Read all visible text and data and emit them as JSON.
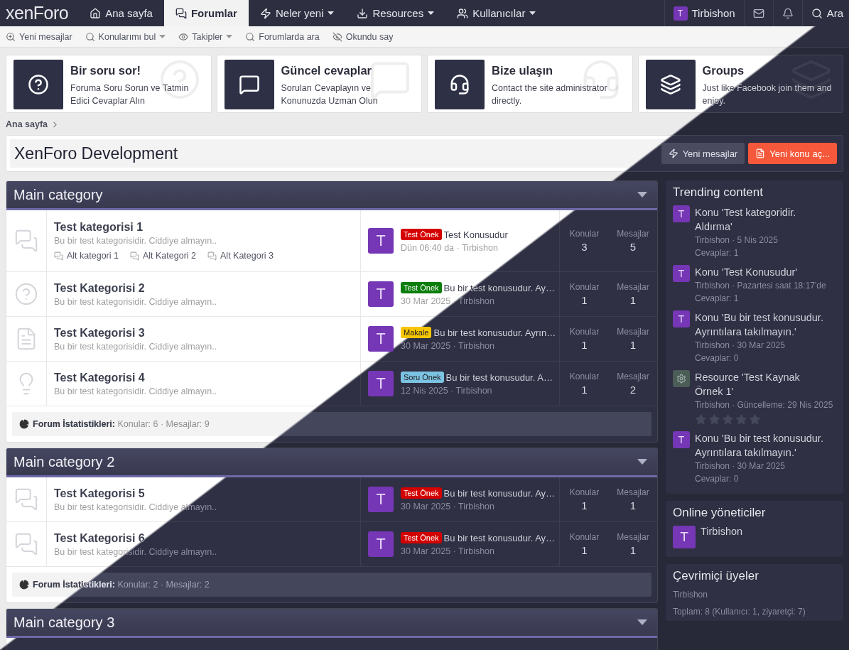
{
  "nav": {
    "logo": "xenForo",
    "tabs": [
      {
        "label": "Ana sayfa",
        "selected": false,
        "dropdown": false
      },
      {
        "label": "Forumlar",
        "selected": true,
        "dropdown": false
      },
      {
        "label": "Neler yeni",
        "selected": false,
        "dropdown": true
      },
      {
        "label": "Resources",
        "selected": false,
        "dropdown": true
      },
      {
        "label": "Kullanıcılar",
        "selected": false,
        "dropdown": true
      }
    ],
    "user": {
      "avatar": "T",
      "name": "Tirbishon"
    },
    "search": "Ara"
  },
  "subnav": [
    {
      "label": "Yeni mesajlar",
      "dropdown": false
    },
    {
      "label": "Konularımı bul",
      "dropdown": true
    },
    {
      "label": "Takipler",
      "dropdown": true
    },
    {
      "label": "Forumlarda ara",
      "dropdown": false
    },
    {
      "label": "Okundu say",
      "dropdown": false
    }
  ],
  "cards": [
    {
      "title": "Bir soru sor!",
      "text": "Foruma Soru Sorun ve Tatmin Edici Cevaplar Alın"
    },
    {
      "title": "Güncel cevaplar",
      "text": "Soruları Cevaplayın ve Konunuzda Uzman Olun"
    },
    {
      "title": "Bize ulaşın",
      "text": "Contact the site administrator directly."
    },
    {
      "title": "Groups",
      "text": "Just like Facebook join them and enjoy."
    }
  ],
  "breadcrumb": [
    "Ana sayfa"
  ],
  "page_title": "XenForo Development",
  "actions": [
    {
      "label": "Yeni mesajlar",
      "kind": "secondary"
    },
    {
      "label": "Yeni konu aç...",
      "kind": "primary"
    }
  ],
  "categories": [
    {
      "title": "Main category",
      "forums": [
        {
          "kind": "chat",
          "title": "Test kategorisi 1",
          "description": "Bu bir test kategorisidir. Ciddiye almayın..",
          "subforums": [
            "Alt kategori 1",
            "Alt Kategori 2",
            "Alt Kategori 3"
          ],
          "last_post": {
            "avatar": "T",
            "prefix": {
              "label": "Test Önek",
              "color": "#d40000"
            },
            "title": "Test Konusudur",
            "meta": "Dün 06:40 da · Tirbishon"
          },
          "threads_label": "Konular",
          "threads": "3",
          "messages_label": "Mesajlar",
          "messages": "5"
        },
        {
          "kind": "question",
          "title": "Test Kategorisi 2",
          "description": "Bu bir test kategorisidir. Ciddiye almayın..",
          "last_post": {
            "avatar": "T",
            "prefix": {
              "label": "Test Önek",
              "color": "#0a7d0a"
            },
            "title": "Bu bir test konusudur. Ay…",
            "meta": "30 Mar 2025 · Tirbishon"
          },
          "threads_label": "Konular",
          "threads": "1",
          "messages_label": "Mesajlar",
          "messages": "1"
        },
        {
          "kind": "document",
          "title": "Test Kategorisi 3",
          "description": "Bu bir test kategorisidir. Ciddiye almayın..",
          "last_post": {
            "avatar": "T",
            "prefix": {
              "label": "Makale",
              "color": "#f7c600"
            },
            "title": "Bu bir test konusudur. Ayrın…",
            "meta": "30 Mar 2025 · Tirbishon"
          },
          "threads_label": "Konular",
          "threads": "1",
          "messages_label": "Mesajlar",
          "messages": "1"
        },
        {
          "kind": "idea",
          "title": "Test Kategorisi 4",
          "description": "Bu bir test kategorisidir. Ciddiye almayın..",
          "last_post": {
            "avatar": "T",
            "prefix": {
              "label": "Soru Önek",
              "color": "#7cc3e3"
            },
            "title": "Bu bir test konusudur. A…",
            "meta": "12 Nis 2025 · Tirbishon"
          },
          "threads_label": "Konular",
          "threads": "1",
          "messages_label": "Mesajlar",
          "messages": "2"
        }
      ],
      "stats": "**Forum İstatistikleri:** Konular: 6 · Mesajlar: 9"
    },
    {
      "title": "Main category 2",
      "forums": [
        {
          "kind": "chat",
          "title": "Test Kategorisi 5",
          "description": "Bu bir test kategorisidir. Ciddiye almayın..",
          "last_post": {
            "avatar": "T",
            "prefix": {
              "label": "Test Önek",
              "color": "#d40000"
            },
            "title": "Bu bir test konusudur. Ay…",
            "meta": "30 Mar 2025 · Tirbishon"
          },
          "threads_label": "Konular",
          "threads": "1",
          "messages_label": "Mesajlar",
          "messages": "1"
        },
        {
          "kind": "chat",
          "title": "Test Kategorisi 6",
          "description": "Bu bir test kategorisidir. Ciddiye almayın..",
          "last_post": {
            "avatar": "T",
            "prefix": {
              "label": "Test Önek",
              "color": "#d40000"
            },
            "title": "Bu bir test konusudur. Ay…",
            "meta": "30 Mar 2025 · Tirbishon"
          },
          "threads_label": "Konular",
          "threads": "1",
          "messages_label": "Mesajlar",
          "messages": "1"
        }
      ],
      "stats": "**Forum İstatistikleri:** Konular: 2 · Mesajlar: 2"
    },
    {
      "title": "Main category 3"
    }
  ],
  "sidebar": [
    {
      "kind": "trending",
      "title": "Trending content",
      "items": [
        {
          "kind": "thread",
          "avatar": "T",
          "title": "Konu 'Test kategoridir. Aldırma'",
          "meta": "Tirbishon · 5 Nis 2025",
          "replies": "Cevaplar: 1"
        },
        {
          "kind": "thread",
          "avatar": "T",
          "title": "Konu 'Test Konusudur'",
          "meta": "Tirbishon · Pazartesi saat 18:17'de",
          "replies": "Cevaplar: 1"
        },
        {
          "kind": "thread",
          "avatar": "T",
          "title": "Konu 'Bu bir test konusudur. Ayrıntılara takılmayın.'",
          "meta": "Tirbishon · 30 Mar 2025",
          "replies": "Cevaplar: 0"
        },
        {
          "kind": "resource",
          "title": "Resource 'Test Kaynak Örnek 1'",
          "meta": "Tirbishon · Güncelleme: 29 Nis 2025",
          "stars": 0
        },
        {
          "kind": "thread",
          "avatar": "T",
          "title": "Konu 'Bu bir test konusudur. Ayrıntılara takılmayın.'",
          "meta": "Tirbishon · 30 Mar 2025",
          "replies": "Cevaplar: 0"
        }
      ]
    },
    {
      "kind": "staff",
      "title": "Online yöneticiler",
      "users": [
        {
          "avatar": "T",
          "name": "Tirbishon"
        }
      ]
    },
    {
      "kind": "members",
      "title": "Çevrimiçi üyeler",
      "members": "Tirbishon",
      "total": "Toplam: 8 (Kullanıcı: 1, ziyaretçi: 7)"
    }
  ]
}
